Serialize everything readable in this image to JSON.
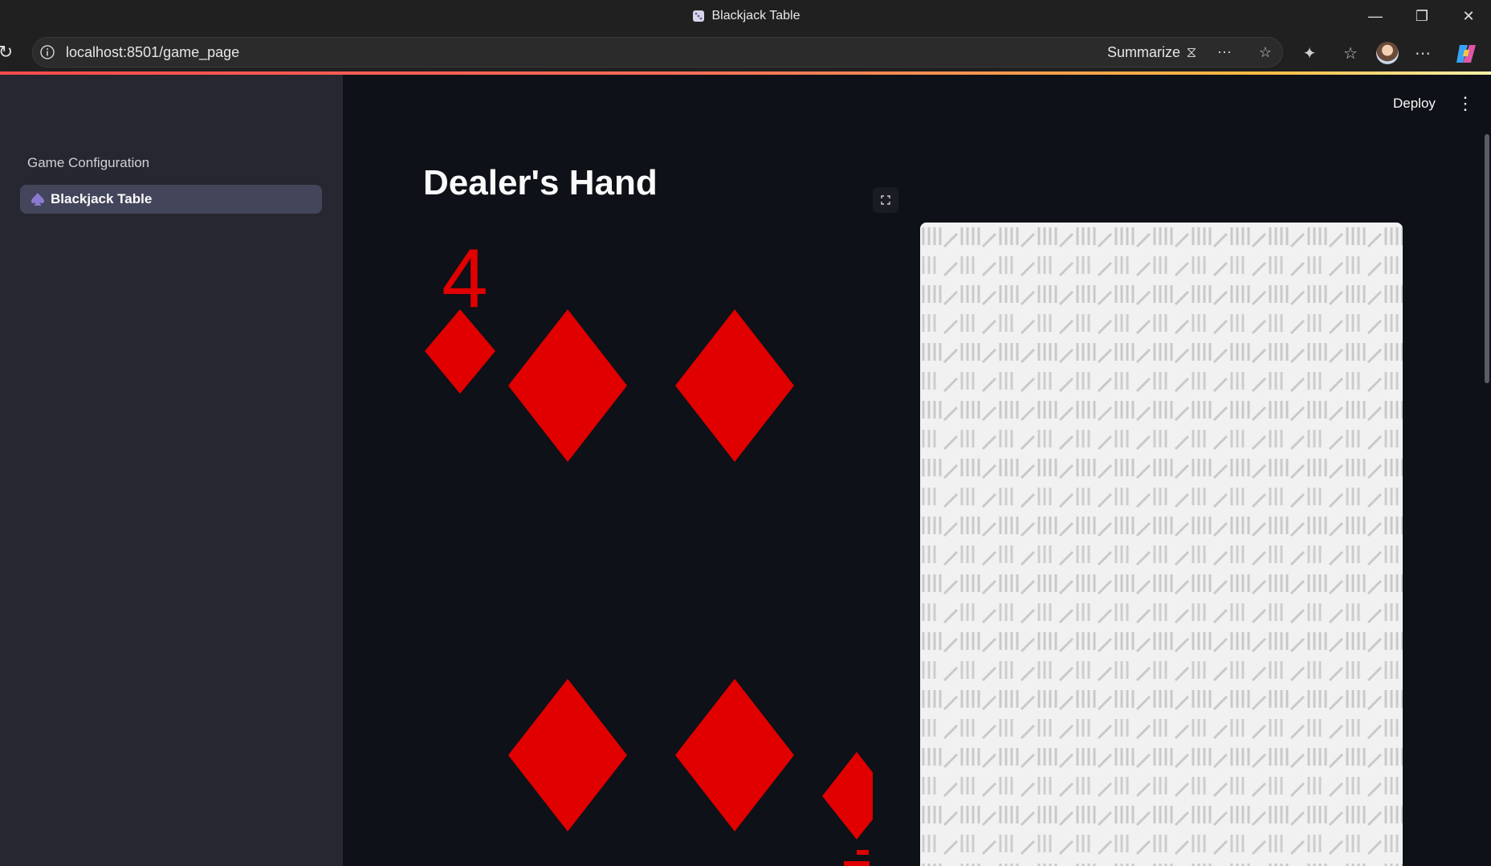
{
  "browser": {
    "window_title": "Blackjack Table",
    "url": "localhost:8501/game_page",
    "summarize_label": "Summarize",
    "icons": [
      "reload-icon",
      "info-icon",
      "copilot-page-icon",
      "reading-mode-icon",
      "favorite-star-icon",
      "extensions-icon",
      "favorites-icon",
      "more-icon",
      "copilot-icon"
    ]
  },
  "sidebar": {
    "heading": "Game Configuration",
    "items": [
      {
        "label": "Blackjack Table",
        "icon": "spade-icon",
        "active": true
      }
    ]
  },
  "header": {
    "deploy_label": "Deploy",
    "menu_icon": "vertical-dots-icon"
  },
  "main": {
    "title": "Dealer's Hand",
    "cards": [
      {
        "rank": "4",
        "suit": "diamonds",
        "face_up": true,
        "color": "#e00000"
      },
      {
        "face_up": false,
        "back_color": "#f1f1f1",
        "pattern_color": "#c8c8c8"
      }
    ]
  },
  "colors": {
    "app_bg": "#0e1117",
    "sidebar_bg": "#262730",
    "active_nav_bg": "#43455a",
    "suit_red": "#e00000"
  }
}
